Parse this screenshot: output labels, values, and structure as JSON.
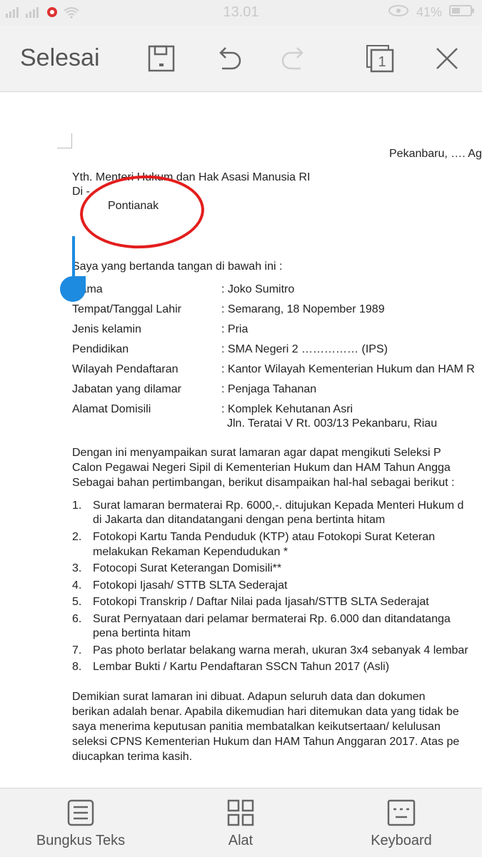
{
  "status_bar": {
    "time": "13.01",
    "battery": "41%"
  },
  "toolbar": {
    "done_label": "Selesai",
    "icons": [
      "save-icon",
      "undo-icon",
      "redo-icon",
      "page-count-icon",
      "close-icon"
    ],
    "page_count": "1"
  },
  "document": {
    "date_line": "Pekanbaru, …. Agu",
    "recipient_line1": "Yth. Menteri Hukum dan Hak Asasi Manusia RI",
    "recipient_line2": "Di -",
    "handwritten_city": "Pontianak",
    "intro": "Saya yang bertanda tangan di bawah ini :",
    "fields": [
      {
        "label": "Nama",
        "value": ": Joko Sumitro"
      },
      {
        "label": "Tempat/Tanggal Lahir",
        "value": ": Semarang, 18 Nopember 1989"
      },
      {
        "label": "Jenis kelamin",
        "value": ": Pria"
      },
      {
        "label": "Pendidikan",
        "value": ": SMA Negeri 2 …………… (IPS)"
      },
      {
        "label": "Wilayah Pendaftaran",
        "value": ": Kantor Wilayah Kementerian Hukum dan HAM R"
      },
      {
        "label": "Jabatan yang dilamar",
        "value": ": Penjaga Tahanan"
      },
      {
        "label": "Alamat Domisili",
        "value": ": Komplek Kehutanan Asri"
      }
    ],
    "address_line2": "Jln. Teratai V Rt. 003/13 Pekanbaru, Riau",
    "para1": [
      "Dengan ini menyampaikan surat lamaran agar dapat mengikuti Seleksi P",
      "Calon Pegawai Negeri Sipil di Kementerian Hukum dan HAM Tahun Angga",
      "Sebagai bahan pertimbangan, berikut disampaikan hal-hal sebagai berikut :"
    ],
    "list": [
      {
        "num": "1.",
        "lines": [
          "Surat lamaran bermaterai Rp. 6000,-. ditujukan Kepada Menteri Hukum d",
          "di Jakarta dan ditandatangani dengan pena bertinta hitam"
        ]
      },
      {
        "num": "2.",
        "lines": [
          "Fotokopi Kartu Tanda Penduduk (KTP) atau Fotokopi Surat Keteran",
          "melakukan Rekaman Kependudukan *"
        ]
      },
      {
        "num": "3.",
        "lines": [
          "Fotocopi Surat Keterangan Domisili**"
        ]
      },
      {
        "num": "4.",
        "lines": [
          "Fotokopi Ijasah/ STTB SLTA Sederajat"
        ]
      },
      {
        "num": "5.",
        "lines": [
          "Fotokopi Transkrip / Daftar Nilai pada Ijasah/STTB  SLTA Sederajat"
        ]
      },
      {
        "num": "6.",
        "lines": [
          "Surat Pernyataan dari pelamar bermaterai Rp. 6.000 dan ditandatanga",
          "pena bertinta hitam"
        ]
      },
      {
        "num": "7.",
        "lines": [
          "Pas photo berlatar belakang warna merah, ukuran 3x4 sebanyak 4 lembar"
        ]
      },
      {
        "num": "8.",
        "lines": [
          "Lembar Bukti / Kartu Pendaftaran SSCN Tahun 2017 (Asli)"
        ]
      }
    ],
    "para2": [
      "Demikian surat lamaran ini dibuat. Adapun seluruh data dan dokumen",
      "berikan adalah benar. Apabila dikemudian hari ditemukan data yang tidak be",
      "saya menerima keputusan panitia membatalkan keikutsertaan/ kelulusan",
      "seleksi CPNS Kementerian Hukum dan HAM Tahun Anggaran 2017. Atas pe",
      "diucapkan terima kasih."
    ]
  },
  "bottom_bar": {
    "items": [
      {
        "label": "Bungkus Teks",
        "icon": "wrap-text-icon"
      },
      {
        "label": "Alat",
        "icon": "tools-grid-icon"
      },
      {
        "label": "Keyboard",
        "icon": "keyboard-icon"
      }
    ]
  },
  "colors": {
    "annotation_red": "#e31d1d",
    "cursor_blue": "#1d8be0"
  }
}
